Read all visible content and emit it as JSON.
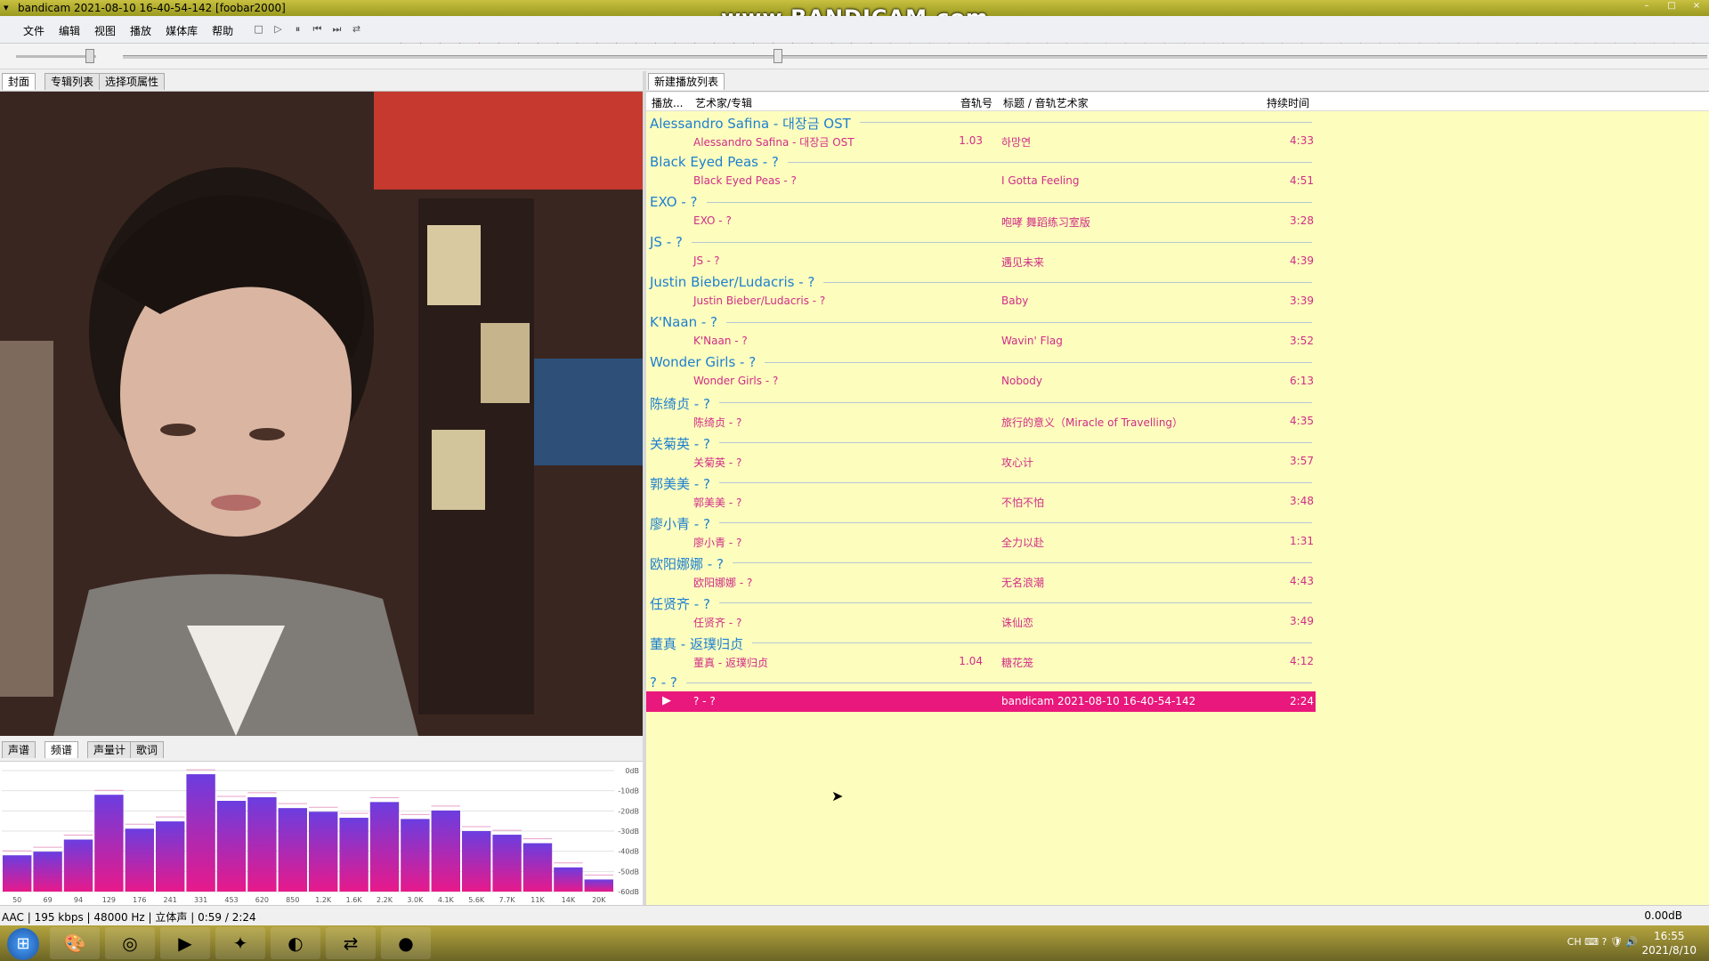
{
  "window": {
    "title": "bandicam 2021-08-10 16-40-54-142  [foobar2000]",
    "watermark": "www.BANDICAM.com",
    "buttons": [
      "–",
      "□",
      "×"
    ]
  },
  "menu": [
    "文件",
    "编辑",
    "视图",
    "播放",
    "媒体库",
    "帮助"
  ],
  "toolbar": {
    "stop": "□",
    "play": "▷",
    "pause": "⏸",
    "prev": "⏮",
    "next": "⏭",
    "random": "⇄"
  },
  "left_tabs": [
    "封面",
    "专辑列表",
    "选择项属性"
  ],
  "vis_tabs": [
    "声谱",
    "频谱",
    "声量计",
    "歌词"
  ],
  "spectrum": {
    "db_labels": [
      "0dB",
      "-10dB",
      "-20dB",
      "-30dB",
      "-40dB",
      "-50dB",
      "-60dB"
    ],
    "freq_labels": [
      "50",
      "69",
      "94",
      "129",
      "176",
      "241",
      "331",
      "453",
      "620",
      "850",
      "1.2K",
      "1.6K",
      "2.2K",
      "3.0K",
      "4.1K",
      "5.6K",
      "7.7K",
      "11K",
      "14K",
      "20K"
    ],
    "levels": [
      0.3,
      0.33,
      0.43,
      0.8,
      0.52,
      0.58,
      0.97,
      0.75,
      0.78,
      0.69,
      0.66,
      0.61,
      0.74,
      0.6,
      0.67,
      0.5,
      0.47,
      0.4,
      0.2,
      0.1
    ]
  },
  "playlist": {
    "tab": "新建播放列表",
    "columns": {
      "playing": "播放...",
      "artist_album": "艺术家/专辑",
      "track_no": "音轨号",
      "title_artist": "标题 / 音轨艺术家",
      "duration": "持续时间"
    },
    "groups": [
      {
        "name": "Alessandro Safina - 대장금 OST",
        "tracks": [
          {
            "artist": "Alessandro Safina - 대장금 OST",
            "no": "1.03",
            "title": "하망연",
            "dur": "4:33"
          }
        ]
      },
      {
        "name": "Black Eyed Peas - ?",
        "tracks": [
          {
            "artist": "Black Eyed Peas - ?",
            "no": "",
            "title": "I Gotta Feeling",
            "dur": "4:51"
          }
        ]
      },
      {
        "name": "EXO - ?",
        "tracks": [
          {
            "artist": "EXO - ?",
            "no": "",
            "title": "咆哮 舞蹈练习室版",
            "dur": "3:28"
          }
        ]
      },
      {
        "name": "JS - ?",
        "tracks": [
          {
            "artist": "JS - ?",
            "no": "",
            "title": "遇见未来",
            "dur": "4:39"
          }
        ]
      },
      {
        "name": "Justin Bieber/Ludacris - ?",
        "tracks": [
          {
            "artist": "Justin Bieber/Ludacris - ?",
            "no": "",
            "title": "Baby",
            "dur": "3:39"
          }
        ]
      },
      {
        "name": "K'Naan - ?",
        "tracks": [
          {
            "artist": "K'Naan - ?",
            "no": "",
            "title": "Wavin' Flag",
            "dur": "3:52"
          }
        ]
      },
      {
        "name": "Wonder Girls - ?",
        "tracks": [
          {
            "artist": "Wonder Girls - ?",
            "no": "",
            "title": "Nobody",
            "dur": "6:13"
          }
        ]
      },
      {
        "name": "陈绮贞 - ?",
        "tracks": [
          {
            "artist": "陈绮贞 - ?",
            "no": "",
            "title": "旅行的意义（Miracle of Travelling）",
            "dur": "4:35"
          }
        ]
      },
      {
        "name": "关菊英 - ?",
        "tracks": [
          {
            "artist": "关菊英 - ?",
            "no": "",
            "title": "攻心计",
            "dur": "3:57"
          }
        ]
      },
      {
        "name": "郭美美 - ?",
        "tracks": [
          {
            "artist": "郭美美 - ?",
            "no": "",
            "title": "不怕不怕",
            "dur": "3:48"
          }
        ]
      },
      {
        "name": "廖小青 - ?",
        "tracks": [
          {
            "artist": "廖小青 - ?",
            "no": "",
            "title": "全力以赴",
            "dur": "1:31"
          }
        ]
      },
      {
        "name": "欧阳娜娜 - ?",
        "tracks": [
          {
            "artist": "欧阳娜娜 - ?",
            "no": "",
            "title": "无名浪潮",
            "dur": "4:43"
          }
        ]
      },
      {
        "name": "任贤齐 - ?",
        "tracks": [
          {
            "artist": "任贤齐 - ?",
            "no": "",
            "title": "诛仙恋",
            "dur": "3:49"
          }
        ]
      },
      {
        "name": "董真 - 返璞归贞",
        "tracks": [
          {
            "artist": "董真 - 返璞归贞",
            "no": "1.04",
            "title": "糖花笼",
            "dur": "4:12"
          }
        ]
      },
      {
        "name": "? - ?",
        "tracks": [
          {
            "artist": "? - ?",
            "no": "",
            "title": "bandicam 2021-08-10 16-40-54-142",
            "dur": "2:24",
            "playing": true
          }
        ]
      }
    ]
  },
  "status": {
    "left": "AAC | 195 kbps | 48000 Hz | 立体声 | 0:59 / 2:24",
    "right": "0.00dB"
  },
  "taskbar": {
    "start": "⊞",
    "apps": [
      "🎨",
      "◎",
      "▶",
      "✦",
      "◐",
      "⇄",
      "●"
    ],
    "tray": "CH  ⌨  ?  🛡  🔊",
    "time": "16:55",
    "date": "2021/8/10"
  },
  "colors": {
    "group": "#1d7fd1",
    "track": "#d02d87",
    "playing_bg": "#e9187c",
    "playlist_bg": "#fdfdbe"
  }
}
